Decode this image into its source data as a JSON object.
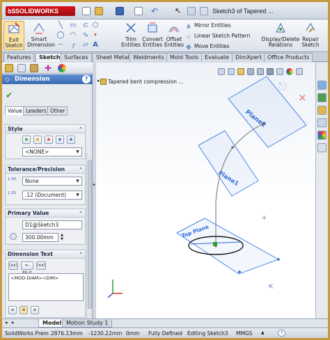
{
  "app": {
    "brand": "SOLIDWORKS",
    "document_title": "Sketch3 of Tapered ..."
  },
  "command_manager": {
    "exit_sketch": "Exit Sketch",
    "smart_dimension": "Smart Dimension",
    "trim_entities": "Trim Entities",
    "convert_entities": "Convert Entities",
    "offset_entities": "Offset Entities",
    "mirror_entities": "Mirror Entities",
    "linear_sketch_pattern": "Linear Sketch Pattern",
    "move_entities": "Move Entities",
    "display_delete_relations": "Display/Delete Relations",
    "repair_sketch": "Repair Sketch"
  },
  "tabs": [
    "Features",
    "Sketch",
    "Surfaces",
    "Sheet Metal",
    "Weldments",
    "Mold Tools",
    "Evaluate",
    "DimXpert",
    "Office Products"
  ],
  "active_tab": "Sketch",
  "property_manager": {
    "title": "Dimension",
    "help": "?",
    "subtabs": [
      "Value",
      "Leaders",
      "Other"
    ],
    "style": {
      "title": "Style",
      "selected": "<NONE>"
    },
    "tolerance": {
      "title": "Tolerance/Precision",
      "tol_icon_text": "1.50",
      "prec_icon_text": "1.55",
      "tolerance_type": "None",
      "precision": ".12 (Document)"
    },
    "primary_value": {
      "title": "Primary Value",
      "name": "D1@Sketch3",
      "value": "300.00mm"
    },
    "dimension_text": {
      "title": "Dimension Text",
      "button1": "(xx)",
      "button2": "<-xx->",
      "button3": "(xx)",
      "text": "<MOD-DIAM><DIM>"
    }
  },
  "graphics": {
    "tree_item": "Tapered bent compression ...",
    "plane1_label": "Plane1",
    "plane2_label": "Plane2",
    "top_plane_label": "Top Plane"
  },
  "bottom_tabs": [
    "Model",
    "Motion Study 1"
  ],
  "status": {
    "product": "SolidWorks Prem",
    "x": "2876.13mm",
    "y": "-1230.22mm",
    "z": "0mm",
    "state": "Fully Defined",
    "editing": "Editing Sketch3",
    "units": "MMGS",
    "help": "?"
  },
  "colors": {
    "brand_red": "#c8161c",
    "pm_header": "#4a7bc2",
    "sketch_blue": "#2d6ad8",
    "plane_blue": "#4a86e8",
    "ok_green": "#2f9e2f",
    "cancel_red": "#d33"
  }
}
